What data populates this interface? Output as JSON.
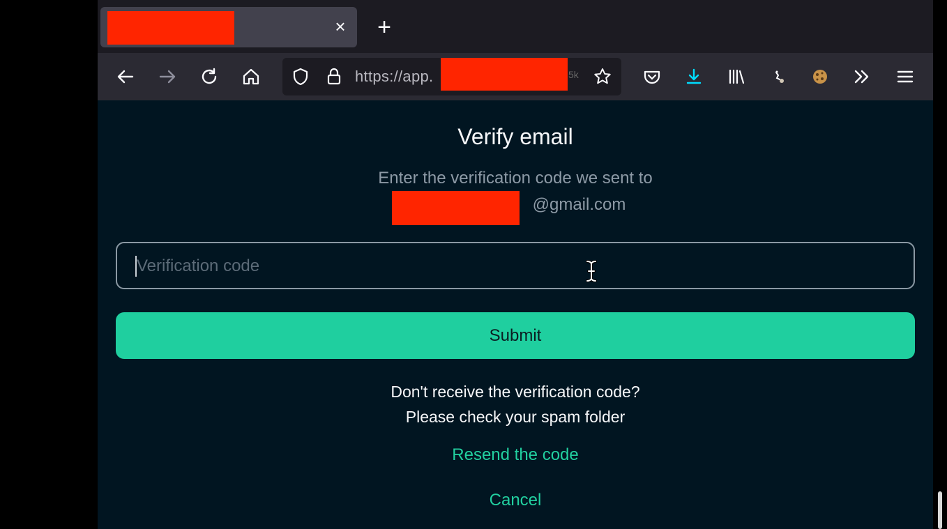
{
  "tab": {
    "close_glyph": "×",
    "new_glyph": "+"
  },
  "urlbar": {
    "url": "https://app.",
    "fade_text": "5k"
  },
  "toolbar": {
    "icons": [
      "back-icon",
      "forward-icon",
      "reload-icon",
      "home-icon",
      "shield-icon",
      "lock-icon",
      "star-icon",
      "pocket-icon",
      "download-icon",
      "library-icon",
      "extension-icon",
      "cookie-icon",
      "overflow-icon",
      "menu-icon"
    ]
  },
  "verify": {
    "title": "Verify email",
    "subtitle": "Enter the verification code we sent to",
    "email_suffix": "@gmail.com",
    "input_placeholder": "Verification code",
    "submit_label": "Submit",
    "help_line1": "Don't receive the verification code?",
    "help_line2": "Please check your spam folder",
    "resend_label": "Resend the code",
    "cancel_label": "Cancel"
  },
  "colors": {
    "accent": "#1fcf9f",
    "background": "#011521",
    "redaction": "#ff2500"
  }
}
